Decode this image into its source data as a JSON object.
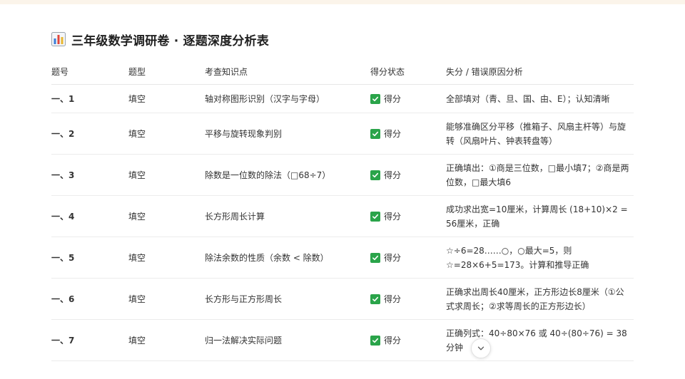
{
  "title": "三年级数学调研卷 · 逐题深度分析表",
  "headers": {
    "num": "题号",
    "type": "题型",
    "knowledge": "考查知识点",
    "status": "得分状态",
    "reason": "失分 / 错误原因分析"
  },
  "rows": [
    {
      "num": "一、1",
      "type": "填空",
      "knowledge": "轴对称图形识别（汉字与字母）",
      "status": "得分",
      "reason": "全部填对（青、旦、国、由、E）；认知清晰"
    },
    {
      "num": "一、2",
      "type": "填空",
      "knowledge": "平移与旋转现象判别",
      "status": "得分",
      "reason": "能够准确区分平移（推箱子、风扇主杆等）与旋转（风扇叶片、钟表转盘等）"
    },
    {
      "num": "一、3",
      "type": "填空",
      "knowledge": "除数是一位数的除法（□68÷7）",
      "status": "得分",
      "reason": "正确填出：①商是三位数，□最小填7；②商是两位数，□最大填6"
    },
    {
      "num": "一、4",
      "type": "填空",
      "knowledge": "长方形周长计算",
      "status": "得分",
      "reason": "成功求出宽=10厘米，计算周长 (18+10)×2 = 56厘米，正确"
    },
    {
      "num": "一、5",
      "type": "填空",
      "knowledge": "除法余数的性质（余数 < 除数）",
      "status": "得分",
      "reason": "☆÷6=28……○，○最大=5，则☆=28×6+5=173。计算和推导正确"
    },
    {
      "num": "一、6",
      "type": "填空",
      "knowledge": "长方形与正方形周长",
      "status": "得分",
      "reason": "正确求出周长40厘米，正方形边长8厘米（①公式求周长；②求等周长的正方形边长）"
    },
    {
      "num": "一、7",
      "type": "填空",
      "knowledge": "归一法解决实际问题",
      "status": "得分",
      "reason": "正确列式：40÷80×76 或 40÷(80÷76) = 38分钟"
    }
  ],
  "colors": {
    "check": "#2aa44a",
    "icon_bar_blue": "#3b7dd8",
    "icon_bar_red": "#e0463c",
    "icon_bar_yellow": "#e8b730"
  },
  "icons": {
    "title_icon": "bar-chart-icon",
    "status_icon": "check-mark-icon",
    "scroll_icon": "chevron-down-icon"
  }
}
